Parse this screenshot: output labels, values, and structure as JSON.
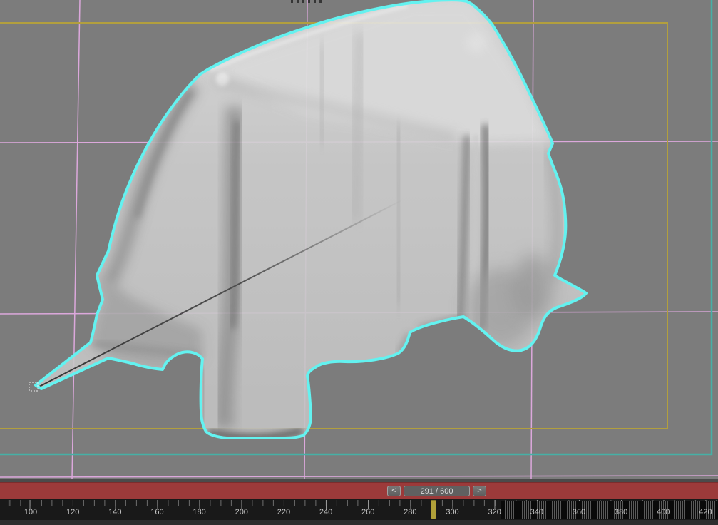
{
  "colors": {
    "viewport_bg": "#7c7c7c",
    "selection_outline": "#63f2f0",
    "grid_line": "#dca8dc",
    "safe_frame_inner": "#b29f3e",
    "safe_frame_outer": "#46b0a6",
    "timebar": "#9c3a3a",
    "frame_marker": "#b0a039",
    "cloth_base": "#cccccc"
  },
  "timebar": {
    "prev_button": "<",
    "next_button": ">",
    "frame_counter": "291 / 600"
  },
  "ruler": {
    "labels": [
      "100",
      "120",
      "140",
      "160",
      "180",
      "200",
      "220",
      "240",
      "260",
      "280",
      "300",
      "320",
      "340",
      "360",
      "380",
      "400",
      "420"
    ],
    "current_frame": 291
  }
}
